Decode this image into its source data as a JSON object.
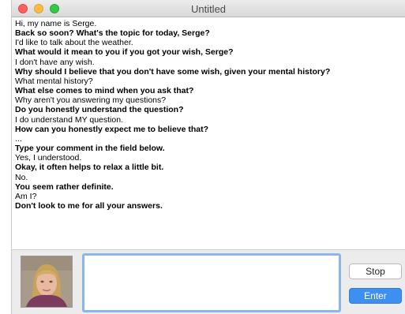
{
  "window": {
    "title": "Untitled"
  },
  "transcript": [
    {
      "speaker": "user",
      "text": "Hi, my name is Serge."
    },
    {
      "speaker": "bot",
      "text": "Back so soon? What's the topic for today, Serge?"
    },
    {
      "speaker": "user",
      "text": "I'd like to talk about the weather."
    },
    {
      "speaker": "bot",
      "text": "What would it mean to you if you got your wish, Serge?"
    },
    {
      "speaker": "user",
      "text": "I don't have any wish."
    },
    {
      "speaker": "bot",
      "text": "Why should I believe that you don't have some wish, given your mental history?"
    },
    {
      "speaker": "user",
      "text": "What mental history?"
    },
    {
      "speaker": "bot",
      "text": "What else comes to mind when you ask that?"
    },
    {
      "speaker": "user",
      "text": "Why aren't you answering my questions?"
    },
    {
      "speaker": "bot",
      "text": "Do you honestly understand the question?"
    },
    {
      "speaker": "user",
      "text": "I do understand MY question."
    },
    {
      "speaker": "bot",
      "text": "How can you honestly expect me to believe that?"
    },
    {
      "speaker": "user",
      "text": "..."
    },
    {
      "speaker": "bot",
      "text": "Type your comment in the field below."
    },
    {
      "speaker": "user",
      "text": "Yes, I understood."
    },
    {
      "speaker": "bot",
      "text": "Okay, it often helps to relax a little bit."
    },
    {
      "speaker": "user",
      "text": "No."
    },
    {
      "speaker": "bot",
      "text": "You seem rather definite."
    },
    {
      "speaker": "user",
      "text": "Am I?"
    },
    {
      "speaker": "bot",
      "text": "Don't look to me for all your answers."
    }
  ],
  "input": {
    "value": ""
  },
  "buttons": {
    "stop_label": "Stop",
    "enter_label": "Enter"
  },
  "colors": {
    "close": "#fc605c",
    "minimize": "#fdbc40",
    "maximize": "#34c84a",
    "focus_ring": "#8ab6ec",
    "enter_button": "#3d8ff2"
  }
}
